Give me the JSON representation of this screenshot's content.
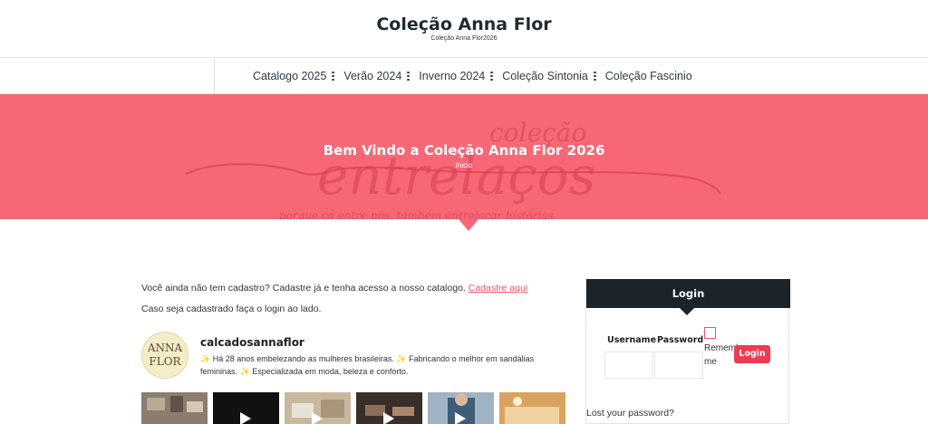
{
  "header": {
    "title": "Coleção Anna Flor",
    "tagline": "Coleção Anna Flor2026"
  },
  "nav": {
    "items": [
      {
        "label": "Catalogo 2025"
      },
      {
        "label": "Verão 2024"
      },
      {
        "label": "Inverno 2024"
      },
      {
        "label": "Coleção Sintonia"
      },
      {
        "label": "Coleção Fascinio"
      }
    ]
  },
  "hero": {
    "title": "Bem Vindo a Coleção Anna Flor 2026",
    "breadcrumb": "Inicio",
    "art_text": {
      "small": "coleção",
      "big": "entrelaços",
      "line": "porque cá entre nós, também entrelaçar histórias"
    },
    "background_color": "#f76775"
  },
  "content": {
    "register_prompt": "Você ainda não tem cadastro? Cadastre já e tenha acesso a nosso catalogo.",
    "register_link": "Cadastre aqui",
    "login_prompt": "Caso seja cadastrado faça o login ao lado."
  },
  "instagram": {
    "avatar_lines": [
      "ANNA",
      "FLOR"
    ],
    "username": "calcadosannaflor",
    "bio_spark": "✨",
    "bio_part1": "Há 28 anos embelezando as mulheres brasileiras.",
    "bio_part2": "Fabricando o melhor em sandálias femininas.",
    "bio_part3": "Especializada em moda, beleza e conforto.",
    "thumbnails": [
      {
        "name": "post-1",
        "color": "#8a7d70"
      },
      {
        "name": "post-2",
        "color": "#111111"
      },
      {
        "name": "post-3",
        "color": "#c9b89e"
      },
      {
        "name": "post-4",
        "color": "#3a2f28"
      },
      {
        "name": "post-5",
        "color": "#9fb3c4"
      },
      {
        "name": "post-6",
        "color": "#d9a35f"
      }
    ]
  },
  "login": {
    "heading": "Login",
    "username_label": "Username",
    "password_label": "Password",
    "remember_label": "Remember me",
    "button_label": "Login",
    "lost_password": "Lost your password?"
  },
  "colors": {
    "accent": "#ef3a52",
    "link": "#e85766",
    "dark": "#1c2329"
  }
}
